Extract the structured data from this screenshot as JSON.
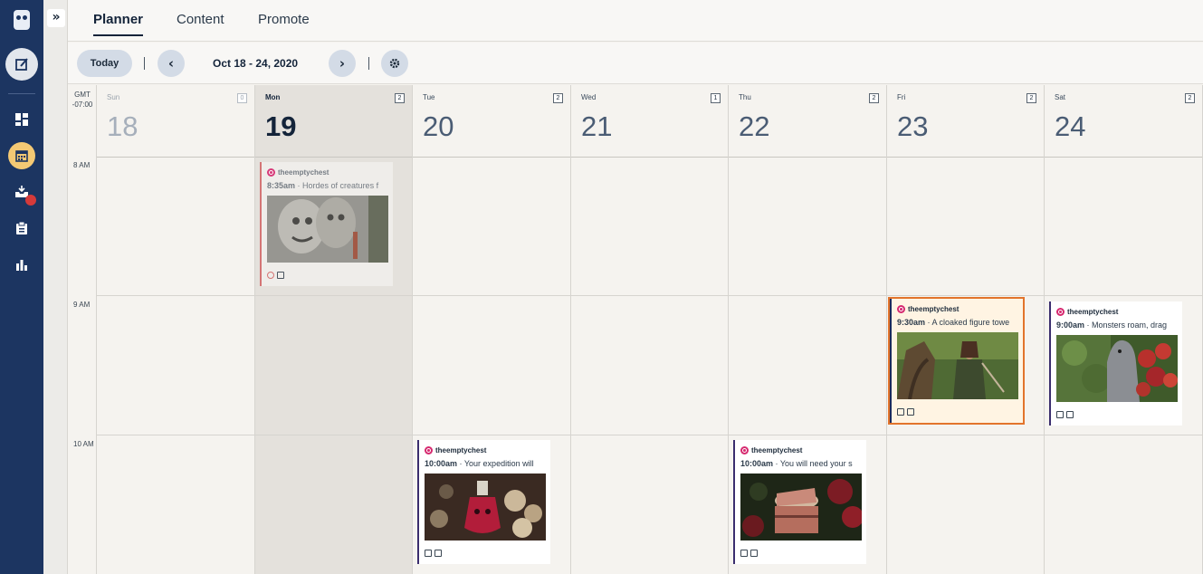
{
  "nav": {
    "expand_glyph": "»",
    "items": [
      {
        "icon": "hootsuite-owl-icon"
      },
      {
        "icon": "compose-icon"
      },
      {
        "icon": "dashboard-icon"
      },
      {
        "icon": "calendar-icon",
        "active": true
      },
      {
        "icon": "inbox-icon",
        "notification": true
      },
      {
        "icon": "clipboard-icon"
      },
      {
        "icon": "analytics-icon"
      }
    ]
  },
  "tabs": [
    "Planner",
    "Content",
    "Promote"
  ],
  "toolbar": {
    "today_label": "Today",
    "prev_glyph": "‹",
    "next_glyph": "›",
    "date_range": "Oct 18 - 24, 2020",
    "settings_icon": "gear-icon"
  },
  "timezone": {
    "line1": "GMT",
    "line2": "-07:00"
  },
  "hours": [
    "8 AM",
    "9 AM",
    "10 AM"
  ],
  "days": [
    {
      "name": "Sun",
      "num": "18",
      "count": "0"
    },
    {
      "name": "Mon",
      "num": "19",
      "count": "2"
    },
    {
      "name": "Tue",
      "num": "20",
      "count": "2"
    },
    {
      "name": "Wed",
      "num": "21",
      "count": "1"
    },
    {
      "name": "Thu",
      "num": "22",
      "count": "2"
    },
    {
      "name": "Fri",
      "num": "23",
      "count": "2"
    },
    {
      "name": "Sat",
      "num": "24",
      "count": "2"
    }
  ],
  "posts": [
    {
      "account": "theemptychest",
      "time": "8:35am",
      "text": " · Hordes of creatures f",
      "image": "stone-gargoyle-carving"
    },
    {
      "account": "theemptychest",
      "time": "9:30am",
      "text": " · A cloaked figure towe",
      "image": "cloaked-figure-forest"
    },
    {
      "account": "theemptychest",
      "time": "9:00am",
      "text": " · Monsters roam, drag",
      "image": "werewolf-red-leaves"
    },
    {
      "account": "theemptychest",
      "time": "10:00am",
      "text": " · Your expedition will",
      "image": "skull-potion-bottle"
    },
    {
      "account": "theemptychest",
      "time": "10:00am",
      "text": " · You will need your s",
      "image": "glowing-treasure-chest"
    }
  ],
  "colors": {
    "rail": "#1c3561",
    "accent": "#f4c974",
    "selected_outline": "#e2742c",
    "instagram": "#d6296f"
  }
}
